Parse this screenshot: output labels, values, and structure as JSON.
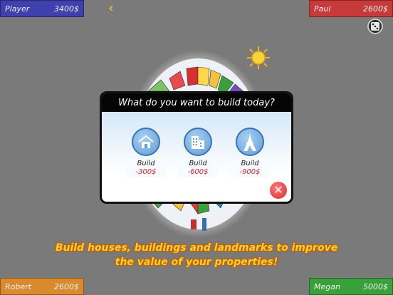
{
  "players": {
    "top_left": {
      "name": "Player",
      "money": "3400$",
      "color": "#3f3fae"
    },
    "top_right": {
      "name": "Paul",
      "money": "2600$",
      "color": "#c83a3a"
    },
    "bottom_left": {
      "name": "Robert",
      "money": "2600$",
      "color": "#d98a2c"
    },
    "bottom_right": {
      "name": "Megan",
      "money": "5000$",
      "color": "#3aa03a"
    }
  },
  "icons": {
    "back": "chevron-left-icon",
    "dice": "dice-icon",
    "sun": "sun-icon",
    "house": "house-icon",
    "building": "building-icon",
    "landmark": "eiffel-tower-icon",
    "close": "close-icon"
  },
  "modal": {
    "title": "What do you want to build today?",
    "options": [
      {
        "label": "Build",
        "price": "-300$"
      },
      {
        "label": "Build",
        "price": "-600$"
      },
      {
        "label": "Build",
        "price": "-900$"
      }
    ]
  },
  "caption": {
    "line1": "Build houses, buildings and landmarks to improve",
    "line2": "the value of your properties!"
  },
  "colors": {
    "background": "#7a7a7a",
    "accent_yellow": "#f6d22a",
    "price_red": "#e02020",
    "close_red": "#d92b2b"
  }
}
